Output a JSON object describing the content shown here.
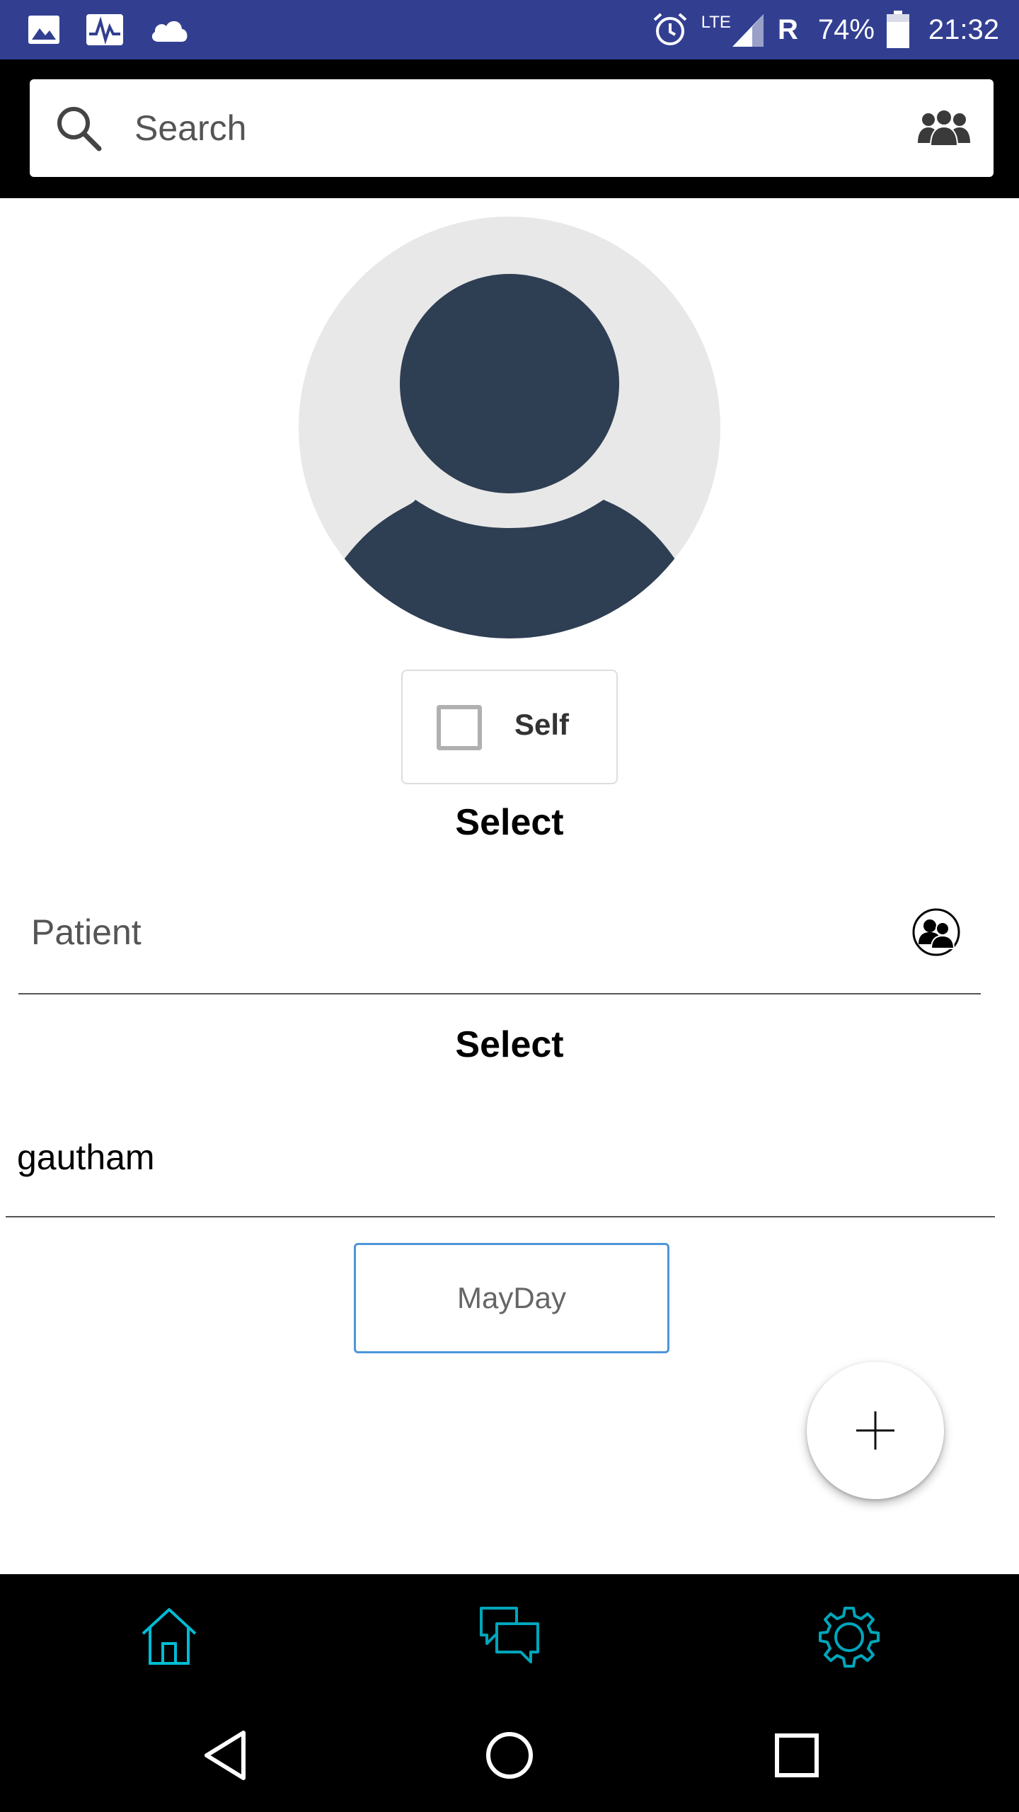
{
  "status_bar": {
    "battery_percent": "74%",
    "time": "21:32",
    "network_type": "LTE",
    "roaming": "R",
    "left_icons": [
      "image-icon",
      "pulse-icon",
      "cloud-icon"
    ],
    "right_icons": [
      "alarm-icon",
      "signal-icon",
      "battery-icon"
    ]
  },
  "search": {
    "placeholder": "Search",
    "value": "",
    "trailing_icon": "group-icon"
  },
  "profile": {
    "avatar_icon": "user-avatar-icon",
    "self_checkbox": {
      "label": "Self",
      "checked": false
    }
  },
  "form": {
    "select_heading_1": "Select",
    "patient_label": "Patient",
    "patient_icon": "contacts-icon",
    "select_heading_2": "Select",
    "name_value": "gautham",
    "mayday_button": "MayDay"
  },
  "fab": {
    "icon": "plus-icon"
  },
  "bottom_nav": {
    "items": [
      {
        "name": "home",
        "icon": "home-icon"
      },
      {
        "name": "chat",
        "icon": "chat-icon"
      },
      {
        "name": "settings",
        "icon": "gear-icon"
      }
    ],
    "accent_color": "#00bcd4"
  },
  "system_nav": {
    "items": [
      "back-icon",
      "home-circle-icon",
      "recents-icon"
    ]
  },
  "colors": {
    "status_bar": "#323f91",
    "avatar_bg": "#e8e8e8",
    "avatar_figure": "#2e3e53",
    "button_border": "#4d96d9"
  }
}
